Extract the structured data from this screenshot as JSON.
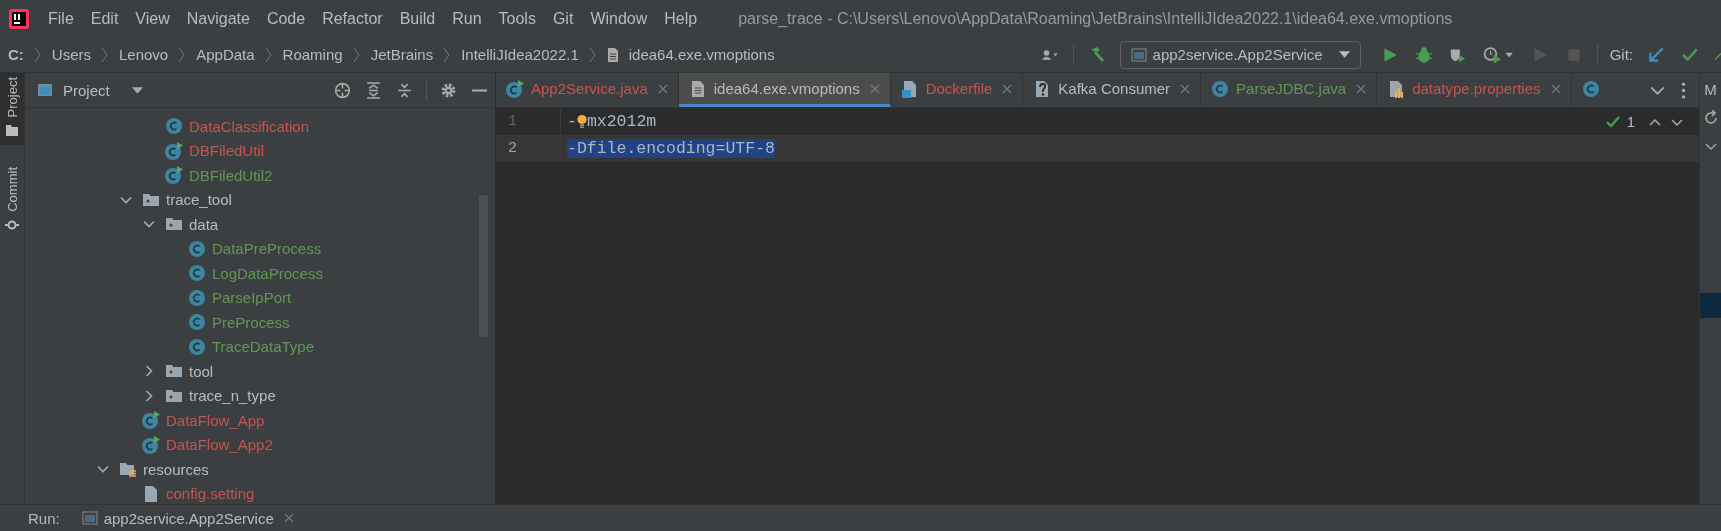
{
  "menu_bar": {
    "items": [
      "File",
      "Edit",
      "View",
      "Navigate",
      "Code",
      "Refactor",
      "Build",
      "Run",
      "Tools",
      "Git",
      "Window",
      "Help"
    ],
    "title": "parse_trace - C:\\Users\\Lenovo\\AppData\\Roaming\\JetBrains\\IntelliJIdea2022.1\\idea64.exe.vmoptions"
  },
  "breadcrumbs": {
    "drive": "C:",
    "items": [
      "Users",
      "Lenovo",
      "AppData",
      "Roaming",
      "JetBrains",
      "IntelliJIdea2022.1"
    ],
    "file": "idea64.exe.vmoptions"
  },
  "toolbar": {
    "run_configuration": "app2service.App2Service",
    "git_label": "Git:"
  },
  "left_strip": [
    {
      "label": "Project",
      "selected": true,
      "kind": "project"
    },
    {
      "label": "Commit",
      "selected": false,
      "kind": "commit"
    }
  ],
  "project_panel": {
    "title": "Project",
    "tree": [
      {
        "children": [
          {
            "children": [
              {
                "label": "DataClassification",
                "kind": "class",
                "color": "#c75450"
              },
              {
                "label": "DBFiledUtil",
                "kind": "runnable-class",
                "color": "#c75450"
              },
              {
                "label": "DBFiledUtil2",
                "kind": "runnable-class",
                "color": "#629755"
              }
            ]
          },
          {
            "label": "trace_tool",
            "kind": "folder",
            "expanded": true,
            "children": [
              {
                "label": "data",
                "kind": "folder",
                "expanded": true,
                "children": [
                  {
                    "label": "DataPreProcess",
                    "kind": "class",
                    "color": "#629755"
                  },
                  {
                    "label": "LogDataProcess",
                    "kind": "class",
                    "color": "#629755"
                  },
                  {
                    "label": "ParseIpPort",
                    "kind": "class",
                    "color": "#629755"
                  },
                  {
                    "label": "PreProcess",
                    "kind": "class",
                    "color": "#629755"
                  },
                  {
                    "label": "TraceDataType",
                    "kind": "class",
                    "color": "#629755"
                  }
                ]
              },
              {
                "label": "tool",
                "kind": "folder",
                "expanded": false
              },
              {
                "label": "trace_n_type",
                "kind": "folder",
                "expanded": false
              }
            ]
          },
          {
            "label": "DataFlow_App",
            "kind": "runnable-class",
            "color": "#c75450"
          },
          {
            "label": "DataFlow_App2",
            "kind": "runnable-class",
            "color": "#c75450"
          }
        ]
      },
      {
        "label": "resources",
        "kind": "resources-folder",
        "expanded": true,
        "children": [
          {
            "label": "config.setting",
            "kind": "file",
            "color": "#c75450"
          }
        ]
      }
    ]
  },
  "editor": {
    "tabs": [
      {
        "label": "App2Service.java",
        "kind": "runnable-class",
        "color": "#c75450",
        "selected": false
      },
      {
        "label": "idea64.exe.vmoptions",
        "kind": "file",
        "selected": true
      },
      {
        "label": "Dockerfile",
        "kind": "docker",
        "color": "#c75450",
        "selected": false
      },
      {
        "label": "Kafka Consumer",
        "kind": "unknown",
        "selected": false
      },
      {
        "label": "ParseJDBC.java",
        "kind": "class",
        "color": "#629755",
        "selected": false
      },
      {
        "label": "datatype.properties",
        "kind": "properties",
        "color": "#c75450",
        "selected": false
      },
      {
        "kind": "class",
        "selected": false
      }
    ],
    "lines": [
      {
        "number": "1",
        "segments": [
          "-",
          "mx2012m"
        ],
        "bulb": true,
        "current": false,
        "selected": false
      },
      {
        "number": "2",
        "segments": [
          "-Dfile.encoding=UTF-8"
        ],
        "bulb": false,
        "current": true,
        "selected": true
      }
    ],
    "inspection_count": "1"
  },
  "right_strip": {
    "label": "M"
  },
  "run_bar": {
    "label": "Run:",
    "tab": "app2service.App2Service"
  }
}
